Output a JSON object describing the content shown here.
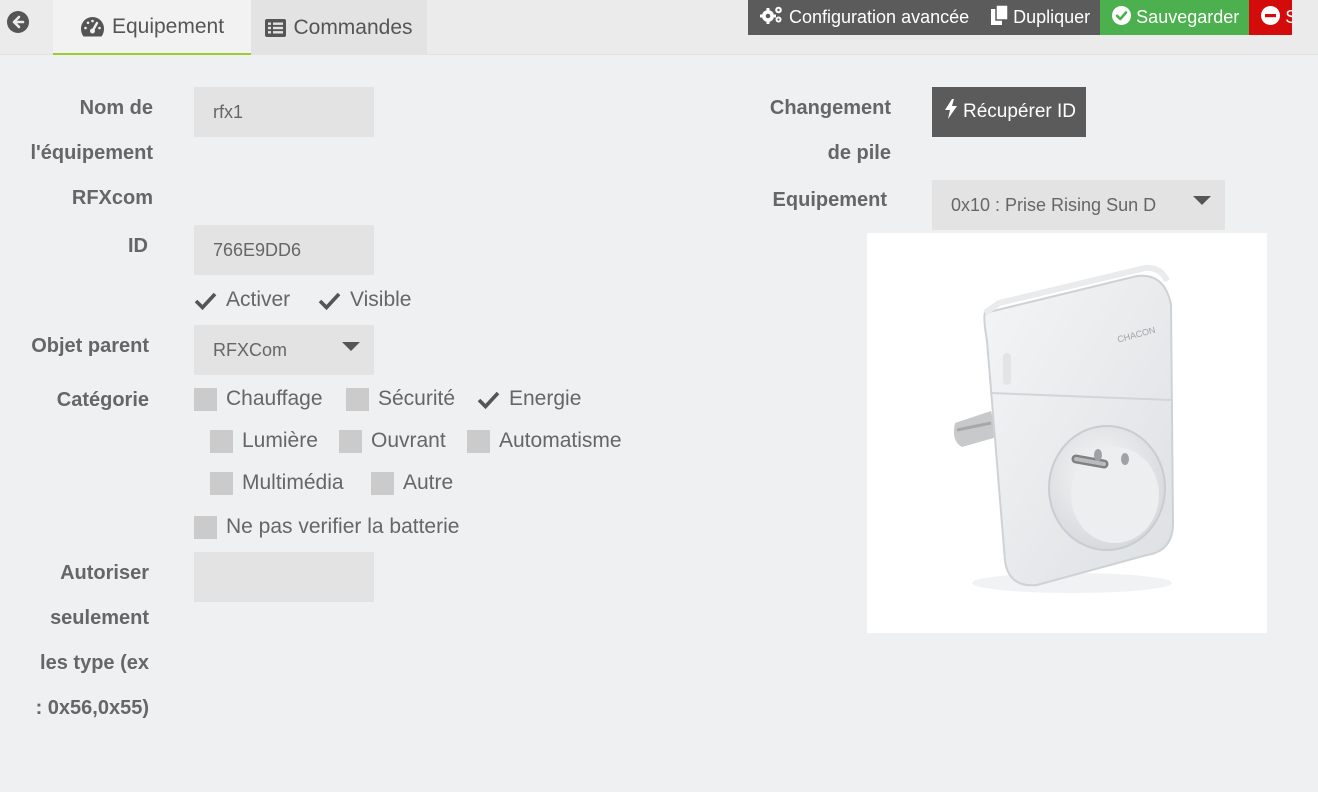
{
  "tabs": [
    {
      "label": "Equipement",
      "icon": "tachometer-icon"
    },
    {
      "label": "Commandes",
      "icon": "list-icon"
    }
  ],
  "actions": {
    "advanced": "Configuration avancée",
    "duplicate": "Dupliquer",
    "save": "Sauvegarder",
    "remove": "S"
  },
  "colors": {
    "accent": "#9acd32",
    "save": "#4cb04f",
    "delete": "#d30b0b",
    "dark_button": "#5b5b5b"
  },
  "form": {
    "name_label": [
      "Nom de",
      "l'équipement",
      "RFXcom"
    ],
    "name_value": "rfx1",
    "id_label": "ID",
    "id_value": "766E9DD6",
    "activate": "Activer",
    "visible": "Visible",
    "parent_label": "Objet parent",
    "parent_value": "RFXCom",
    "category_label": "Catégorie",
    "categories": [
      {
        "label": "Chauffage",
        "checked": false
      },
      {
        "label": "Sécurité",
        "checked": false
      },
      {
        "label": "Energie",
        "checked": true
      },
      {
        "label": "Lumière",
        "checked": false
      },
      {
        "label": "Ouvrant",
        "checked": false
      },
      {
        "label": "Automatisme",
        "checked": false
      },
      {
        "label": "Multimédia",
        "checked": false
      },
      {
        "label": "Autre",
        "checked": false
      }
    ],
    "battery": "Ne pas verifier la batterie",
    "allow_label": [
      "Autoriser",
      "seulement",
      "les type (ex",
      ": 0x56,0x55)"
    ],
    "allow_value": "",
    "battery_change_label": [
      "Changement",
      "de pile"
    ],
    "get_id_button": "Récupérer ID",
    "equipment_label": "Equipement",
    "equipment_value": "0x10 : Prise Rising Sun D",
    "device_logo": "CHACON"
  }
}
